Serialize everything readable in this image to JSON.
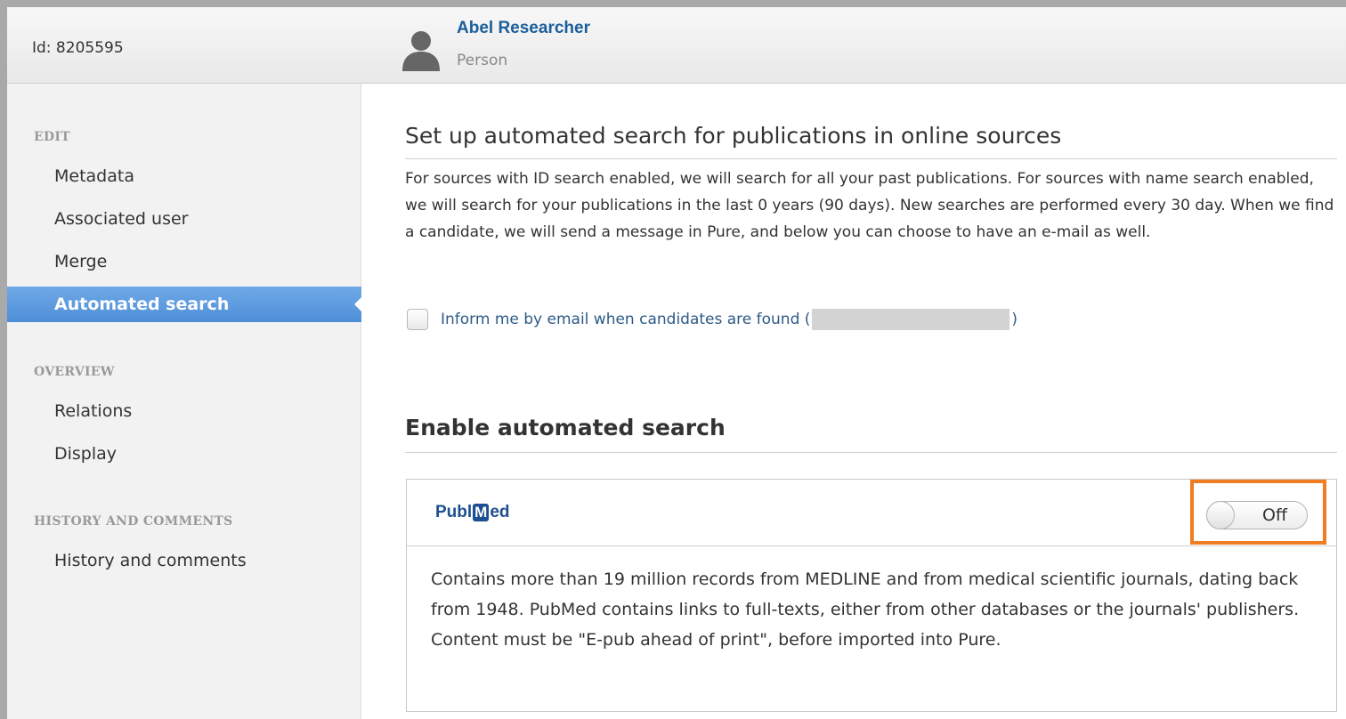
{
  "header": {
    "id_label": "Id: 8205595",
    "name": "Abel Researcher",
    "type": "Person"
  },
  "sidebar": {
    "sections": [
      {
        "label": "EDIT"
      },
      {
        "label": "OVERVIEW"
      },
      {
        "label": "HISTORY AND COMMENTS"
      }
    ],
    "items": [
      {
        "label": "Metadata"
      },
      {
        "label": "Associated user"
      },
      {
        "label": "Merge"
      },
      {
        "label": "Automated search",
        "active": true
      },
      {
        "label": "Relations"
      },
      {
        "label": "Display"
      },
      {
        "label": "History and comments"
      }
    ]
  },
  "main": {
    "title": "Set up automated search for publications in online sources",
    "intro": "For sources with ID search enabled, we will search for all your past publications. For sources with name search enabled, we will search for your publications in the last 0 years (90 days). New searches are performed every 30 day. When we find a candidate, we will send a message in Pure, and below you can choose to have an e-mail as well.",
    "email_checkbox": {
      "label_prefix": "Inform me by email when candidates are found (",
      "label_suffix": ")",
      "checked": false
    },
    "section2_title": "Enable automated search",
    "source": {
      "logo_pre": "Publ",
      "logo_m": "M",
      "logo_post": "ed",
      "toggle_label": "Off",
      "description": "Contains more than 19 million records from MEDLINE and from medical scientific journals, dating back from 1948. PubMed contains links to full-texts, either from other databases or the journals' publishers. Content must be \"E-pub ahead of print\", before imported into Pure."
    }
  },
  "colors": {
    "accent": "#4f8fd8",
    "link": "#1a5e9a",
    "highlight": "#f07d22"
  }
}
